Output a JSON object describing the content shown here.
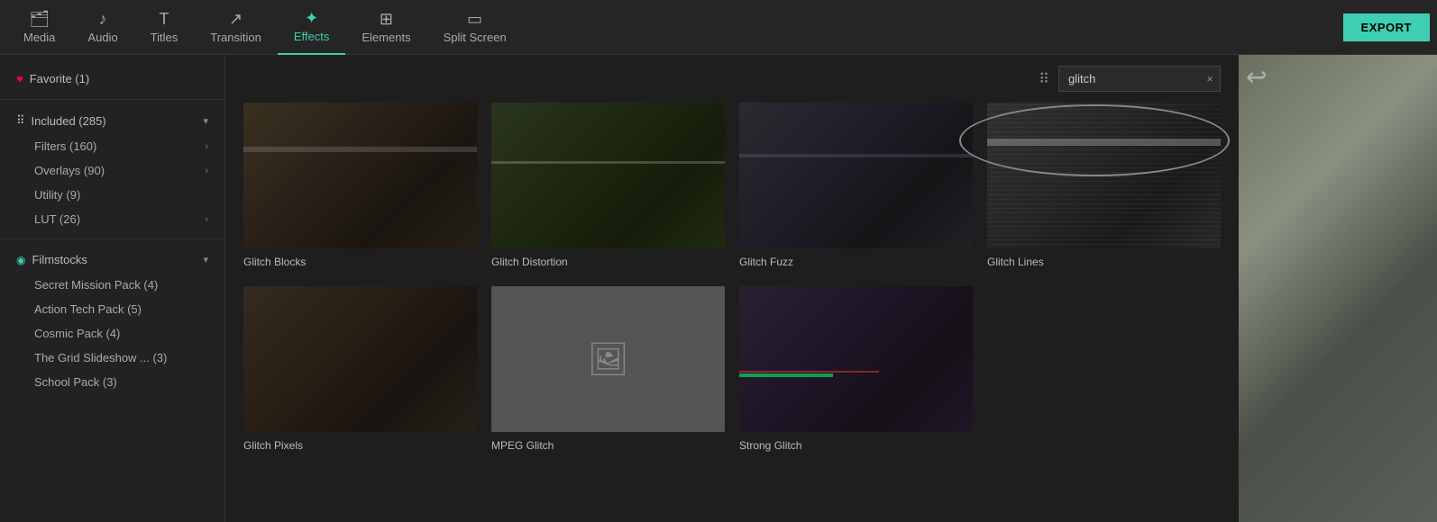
{
  "nav": {
    "items": [
      {
        "id": "media",
        "label": "Media",
        "icon": "🗂",
        "active": false
      },
      {
        "id": "audio",
        "label": "Audio",
        "icon": "♪",
        "active": false
      },
      {
        "id": "titles",
        "label": "Titles",
        "icon": "T",
        "active": false
      },
      {
        "id": "transition",
        "label": "Transition",
        "icon": "↗",
        "active": false
      },
      {
        "id": "effects",
        "label": "Effects",
        "icon": "✦",
        "active": true
      },
      {
        "id": "elements",
        "label": "Elements",
        "icon": "⊞",
        "active": false
      },
      {
        "id": "split-screen",
        "label": "Split Screen",
        "icon": "▭",
        "active": false
      }
    ],
    "export_label": "EXPORT"
  },
  "sidebar": {
    "favorite": {
      "label": "Favorite (1)"
    },
    "included": {
      "label": "Included (285)",
      "children": [
        {
          "label": "Filters (160)",
          "has_arrow": true
        },
        {
          "label": "Overlays (90)",
          "has_arrow": true
        },
        {
          "label": "Utility (9)",
          "has_arrow": false
        },
        {
          "label": "LUT (26)",
          "has_arrow": true
        }
      ]
    },
    "filmstocks": {
      "label": "Filmstocks",
      "children": [
        {
          "label": "Secret Mission Pack (4)"
        },
        {
          "label": "Action Tech Pack (5)"
        },
        {
          "label": "Cosmic Pack (4)"
        },
        {
          "label": "The Grid Slideshow ... (3)"
        },
        {
          "label": "School Pack (3)"
        }
      ]
    }
  },
  "search": {
    "value": "glitch",
    "placeholder": "Search",
    "clear_label": "×",
    "grid_icon": "⠿"
  },
  "effects": [
    {
      "id": "glitch-blocks",
      "label": "Glitch Blocks",
      "thumb_class": "thumb-glitch-blocks"
    },
    {
      "id": "glitch-distortion",
      "label": "Glitch Distortion",
      "thumb_class": "thumb-glitch-distortion"
    },
    {
      "id": "glitch-fuzz",
      "label": "Glitch Fuzz",
      "thumb_class": "thumb-glitch-fuzz"
    },
    {
      "id": "glitch-lines",
      "label": "Glitch Lines",
      "thumb_class": "thumb-glitch-lines"
    },
    {
      "id": "glitch-pixels",
      "label": "Glitch Pixels",
      "thumb_class": "thumb-glitch-pixels"
    },
    {
      "id": "mpeg-glitch",
      "label": "MPEG Glitch",
      "thumb_class": "thumb-mpeg-glitch"
    },
    {
      "id": "strong-glitch",
      "label": "Strong Glitch",
      "thumb_class": "thumb-strong-glitch"
    }
  ]
}
